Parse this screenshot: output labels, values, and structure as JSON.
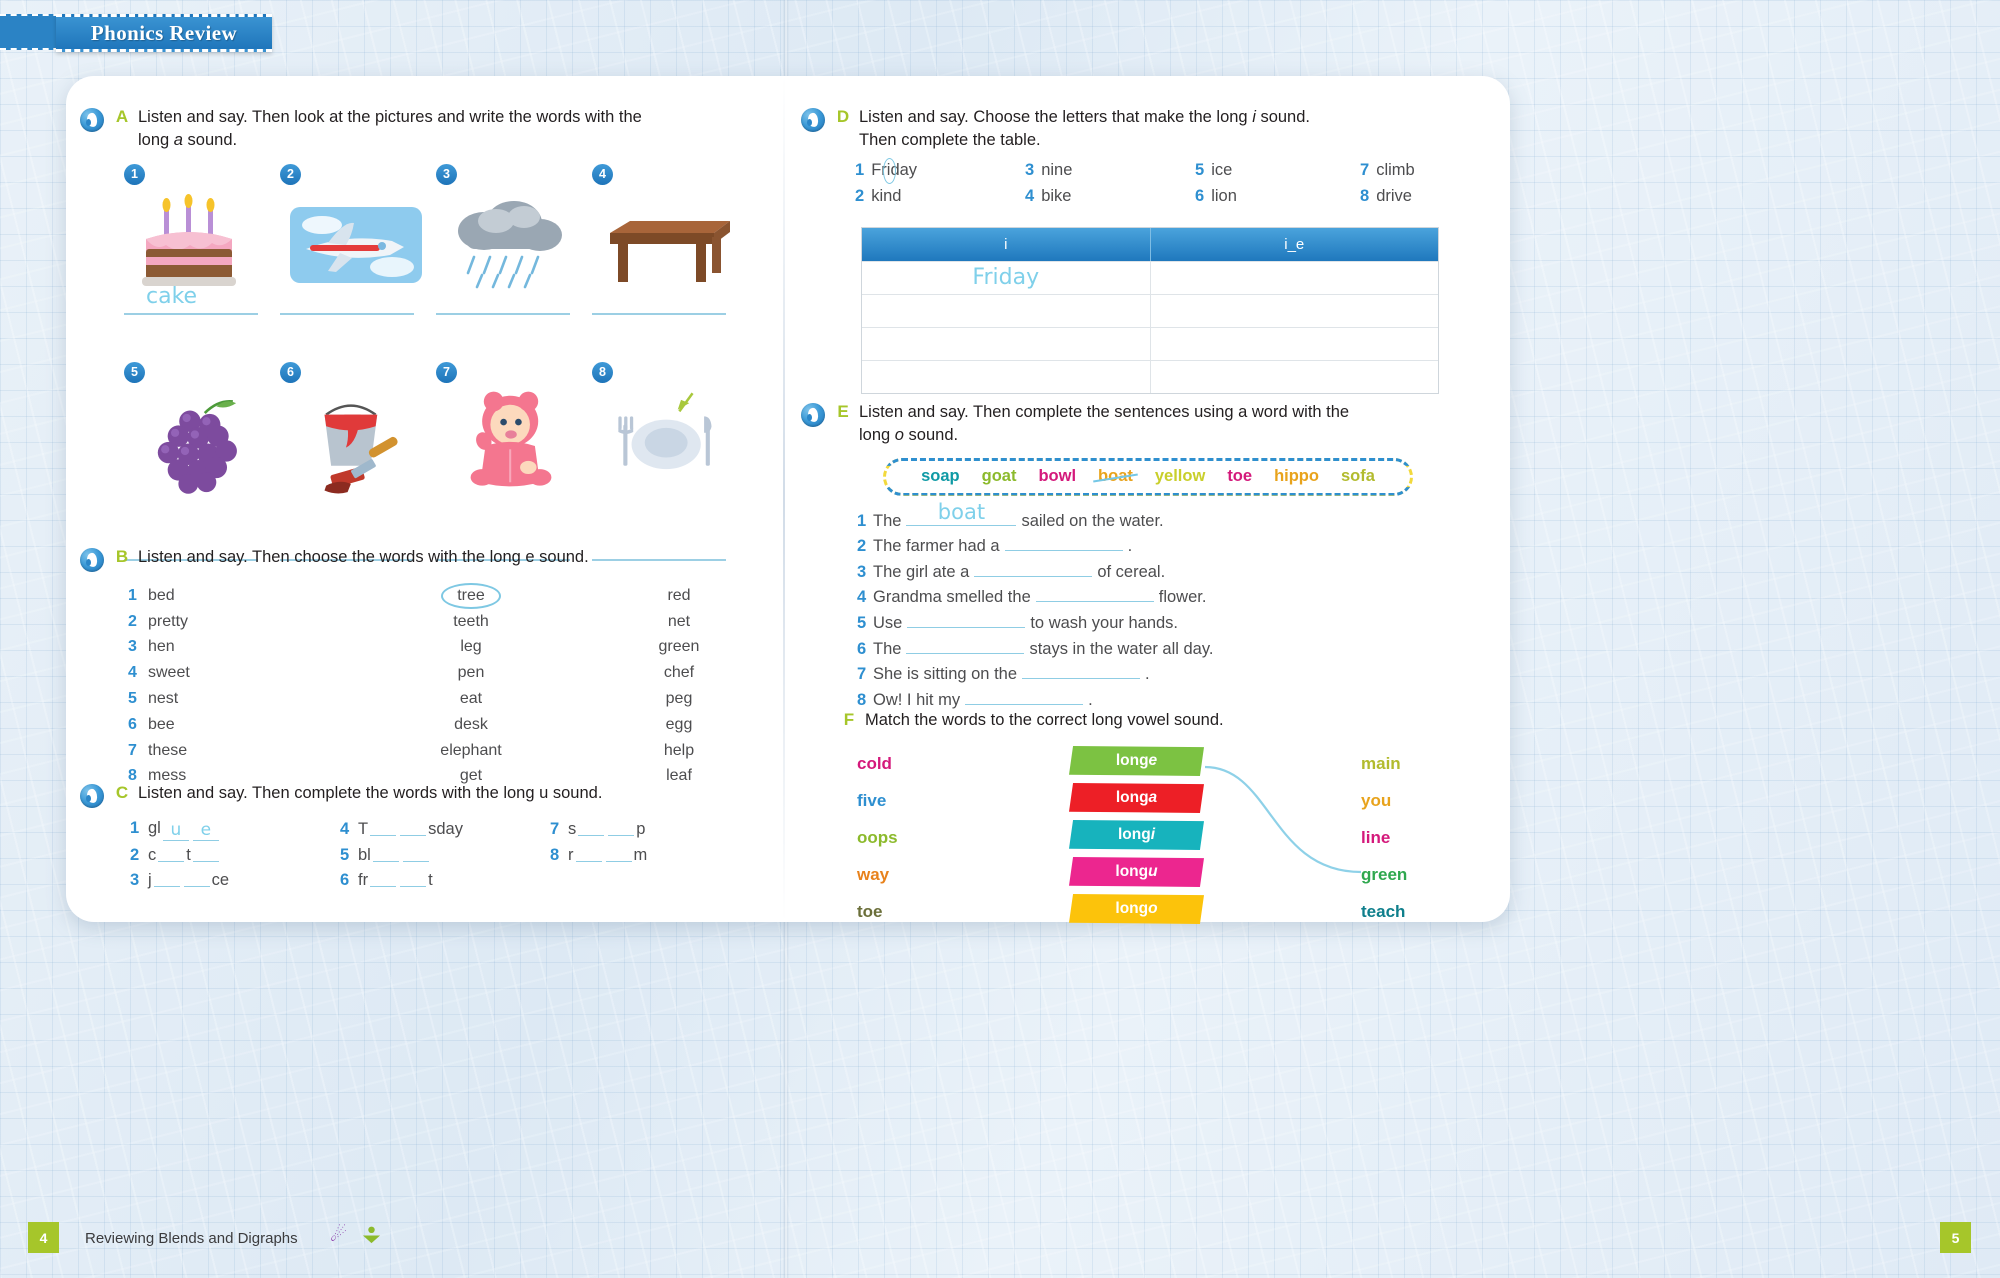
{
  "header": {
    "title": "Phonics Review"
  },
  "exercises": {
    "A": {
      "letter": "A",
      "title_line1": "Listen and say. Then look at the pictures and write the words with the",
      "title_line2_pre": "long ",
      "title_line2_em": "a",
      "title_line2_post": " sound.",
      "items": [
        {
          "num": "1",
          "picture": "birthday-cake",
          "answer": "cake"
        },
        {
          "num": "2",
          "picture": "airplane",
          "answer": ""
        },
        {
          "num": "3",
          "picture": "rain-cloud",
          "answer": ""
        },
        {
          "num": "4",
          "picture": "table",
          "answer": ""
        },
        {
          "num": "5",
          "picture": "grapes",
          "answer": ""
        },
        {
          "num": "6",
          "picture": "paint-bucket-brush",
          "answer": ""
        },
        {
          "num": "7",
          "picture": "baby",
          "answer": ""
        },
        {
          "num": "8",
          "picture": "plate-fork-knife",
          "answer": ""
        }
      ]
    },
    "B": {
      "letter": "B",
      "title": "Listen and say. Then choose the words with the long e sound.",
      "rows": [
        {
          "num": "1",
          "c1": "bed",
          "c2": "tree",
          "c3": "red",
          "circled": "c2"
        },
        {
          "num": "2",
          "c1": "pretty",
          "c2": "teeth",
          "c3": "net",
          "circled": ""
        },
        {
          "num": "3",
          "c1": "hen",
          "c2": "leg",
          "c3": "green",
          "circled": ""
        },
        {
          "num": "4",
          "c1": "sweet",
          "c2": "pen",
          "c3": "chef",
          "circled": ""
        },
        {
          "num": "5",
          "c1": "nest",
          "c2": "eat",
          "c3": "peg",
          "circled": ""
        },
        {
          "num": "6",
          "c1": "bee",
          "c2": "desk",
          "c3": "egg",
          "circled": ""
        },
        {
          "num": "7",
          "c1": "these",
          "c2": "elephant",
          "c3": "help",
          "circled": ""
        },
        {
          "num": "8",
          "c1": "mess",
          "c2": "get",
          "c3": "leaf",
          "circled": ""
        }
      ]
    },
    "C": {
      "letter": "C",
      "title": "Listen and say. Then complete the words with the long u sound.",
      "items": [
        {
          "num": "1",
          "pre": "gl",
          "mid": "",
          "post": "",
          "fill1": "u",
          "fill2": "e"
        },
        {
          "num": "2",
          "pre": "c",
          "mid": "t",
          "post": "",
          "fill1": "",
          "fill2": ""
        },
        {
          "num": "3",
          "pre": "j",
          "mid": "",
          "post": "ce",
          "fill1": "",
          "fill2": ""
        },
        {
          "num": "4",
          "pre": "T",
          "mid": "",
          "post": "sday",
          "fill1": "",
          "fill2": ""
        },
        {
          "num": "5",
          "pre": "bl",
          "mid": "",
          "post": "",
          "fill1": "",
          "fill2": ""
        },
        {
          "num": "6",
          "pre": "fr",
          "mid": "",
          "post": "t",
          "fill1": "",
          "fill2": ""
        },
        {
          "num": "7",
          "pre": "s",
          "mid": "",
          "post": "p",
          "fill1": "",
          "fill2": ""
        },
        {
          "num": "8",
          "pre": "r",
          "mid": "",
          "post": "m",
          "fill1": "",
          "fill2": ""
        }
      ]
    },
    "D": {
      "letter": "D",
      "title_line1_pre": "Listen and say. Choose the letters that make the long ",
      "title_line1_em": "i",
      "title_line1_post": " sound.",
      "title_line2": "Then complete the table.",
      "words": [
        {
          "num": "1",
          "word_pre": "Fr",
          "word_circle": "i",
          "word_post": "day"
        },
        {
          "num": "2",
          "word_pre": "kind",
          "word_circle": "",
          "word_post": ""
        },
        {
          "num": "3",
          "word_pre": "nine",
          "word_circle": "",
          "word_post": ""
        },
        {
          "num": "4",
          "word_pre": "bike",
          "word_circle": "",
          "word_post": ""
        },
        {
          "num": "5",
          "word_pre": "ice",
          "word_circle": "",
          "word_post": ""
        },
        {
          "num": "6",
          "word_pre": "lion",
          "word_circle": "",
          "word_post": ""
        },
        {
          "num": "7",
          "word_pre": "climb",
          "word_circle": "",
          "word_post": ""
        },
        {
          "num": "8",
          "word_pre": "drive",
          "word_circle": "",
          "word_post": ""
        }
      ],
      "table": {
        "headers": [
          "i",
          "i_e"
        ],
        "rows": [
          {
            "col1": "Friday",
            "col2": ""
          },
          {
            "col1": "",
            "col2": ""
          },
          {
            "col1": "",
            "col2": ""
          },
          {
            "col1": "",
            "col2": ""
          }
        ]
      }
    },
    "E": {
      "letter": "E",
      "title_line1": "Listen and say. Then complete the sentences using a word with the",
      "title_line2_pre": "long ",
      "title_line2_em": "o",
      "title_line2_post": " sound.",
      "word_bank": [
        {
          "word": "soap",
          "color": "#0f9aa5",
          "struck": false
        },
        {
          "word": "goat",
          "color": "#8cba2c",
          "struck": false
        },
        {
          "word": "bowl",
          "color": "#d4197b",
          "struck": false
        },
        {
          "word": "boat",
          "color": "#e8a31c",
          "struck": true
        },
        {
          "word": "yellow",
          "color": "#c9cf2b",
          "struck": false
        },
        {
          "word": "toe",
          "color": "#d4197b",
          "struck": false
        },
        {
          "word": "hippo",
          "color": "#e8a31c",
          "struck": false
        },
        {
          "word": "sofa",
          "color": "#b2bb2e",
          "struck": false
        }
      ],
      "sentences": [
        {
          "num": "1",
          "pre": "The",
          "fill": "boat",
          "post": "sailed on the water.",
          "blank_w": 110
        },
        {
          "num": "2",
          "pre": "The farmer had a",
          "fill": "",
          "post": ".",
          "blank_w": 118
        },
        {
          "num": "3",
          "pre": "The girl ate a",
          "fill": "",
          "post": "of cereal.",
          "blank_w": 118
        },
        {
          "num": "4",
          "pre": "Grandma smelled the",
          "fill": "",
          "post": "flower.",
          "blank_w": 118
        },
        {
          "num": "5",
          "pre": "Use",
          "fill": "",
          "post": "to wash your hands.",
          "blank_w": 118
        },
        {
          "num": "6",
          "pre": "The",
          "fill": "",
          "post": "stays in the water all day.",
          "blank_w": 118
        },
        {
          "num": "7",
          "pre": "She is sitting on the",
          "fill": "",
          "post": ".",
          "blank_w": 118
        },
        {
          "num": "8",
          "pre": "Ow! I hit my",
          "fill": "",
          "post": ".",
          "blank_w": 118
        }
      ]
    },
    "F": {
      "letter": "F",
      "title": "Match the words to the correct long vowel sound.",
      "left_words": [
        {
          "word": "cold",
          "color": "#d4197b"
        },
        {
          "word": "five",
          "color": "#2e8fd0"
        },
        {
          "word": "oops",
          "color": "#8cba2c"
        },
        {
          "word": "way",
          "color": "#e8821c"
        },
        {
          "word": "toe",
          "color": "#6b6f3a"
        }
      ],
      "banners": [
        {
          "label_pre": "long ",
          "label_em": "e",
          "color": "#7cc242"
        },
        {
          "label_pre": "long ",
          "label_em": "a",
          "color": "#ed1f26"
        },
        {
          "label_pre": "long ",
          "label_em": "i",
          "color": "#17b3bd"
        },
        {
          "label_pre": "long ",
          "label_em": "u",
          "color": "#ec268f"
        },
        {
          "label_pre": "long ",
          "label_em": "o",
          "color": "#fcc30b"
        }
      ],
      "right_words": [
        {
          "word": "main",
          "color": "#b2bb2e"
        },
        {
          "word": "you",
          "color": "#e8a31c"
        },
        {
          "word": "line",
          "color": "#d4197b"
        },
        {
          "word": "green",
          "color": "#2fa84f"
        },
        {
          "word": "teach",
          "color": "#0f7f8c"
        }
      ],
      "match_line": "long-e-to-green"
    }
  },
  "footer": {
    "left_page_number": "4",
    "right_page_number": "5",
    "caption": "Reviewing Blends and Digraphs"
  }
}
